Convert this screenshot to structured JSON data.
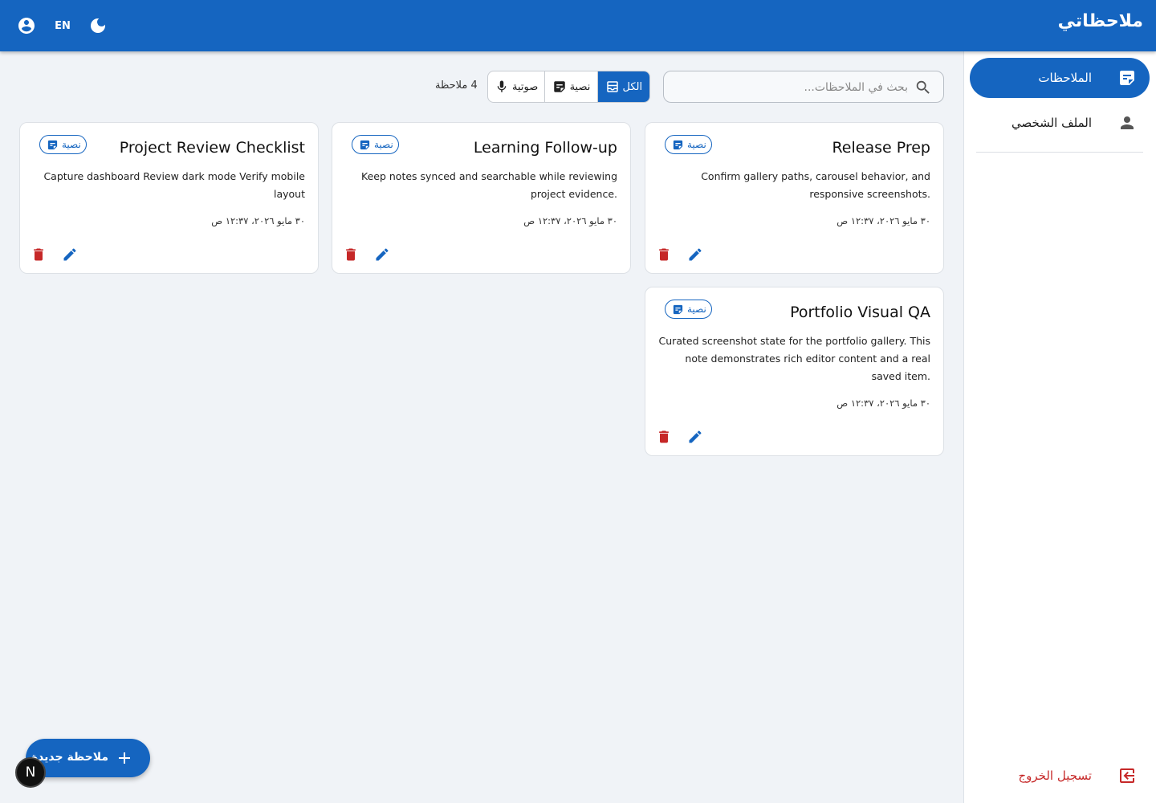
{
  "header": {
    "title": "ملاحظاتي",
    "lang_label": "EN",
    "account_icon": "account-circle-icon",
    "theme_icon": "dark-mode-icon"
  },
  "sidebar": {
    "items": [
      {
        "label": "الملاحظات",
        "icon": "note-icon",
        "active": true
      },
      {
        "label": "الملف الشخصي",
        "icon": "person-icon",
        "active": false
      }
    ],
    "logout_label": "تسجيل الخروج"
  },
  "search": {
    "placeholder": "بحث في الملاحظات..."
  },
  "filters": {
    "all": "الكل",
    "text": "نصية",
    "audio": "صوتية",
    "selected": "الكل"
  },
  "count_label": "4 ملاحظة",
  "notes": [
    {
      "title": "Release Prep",
      "type": "نصية",
      "body": "Confirm gallery paths, carousel behavior, and responsive screenshots.",
      "date": "٣٠ مايو ٢٠٢٦، ١٢:٣٧ ص"
    },
    {
      "title": "Learning Follow-up",
      "type": "نصية",
      "body": "Keep notes synced and searchable while reviewing project evidence.",
      "date": "٣٠ مايو ٢٠٢٦، ١٢:٣٧ ص"
    },
    {
      "title": "Project Review Checklist",
      "type": "نصية",
      "body": "Capture dashboard Review dark mode Verify mobile layout",
      "date": "٣٠ مايو ٢٠٢٦، ١٢:٣٧ ص"
    },
    {
      "title": "Portfolio Visual QA",
      "type": "نصية",
      "body": "Curated screenshot state for the portfolio gallery. This note demonstrates rich editor content and a real saved item.",
      "date": "٣٠ مايو ٢٠٢٦، ١٢:٣٧ ص"
    }
  ],
  "fab": {
    "label": "ملاحظة جديدة"
  },
  "dev_badge": {
    "label": "N"
  },
  "colors": {
    "primary": "#1565c0",
    "danger": "#c62828",
    "background": "#f0f3f7"
  }
}
